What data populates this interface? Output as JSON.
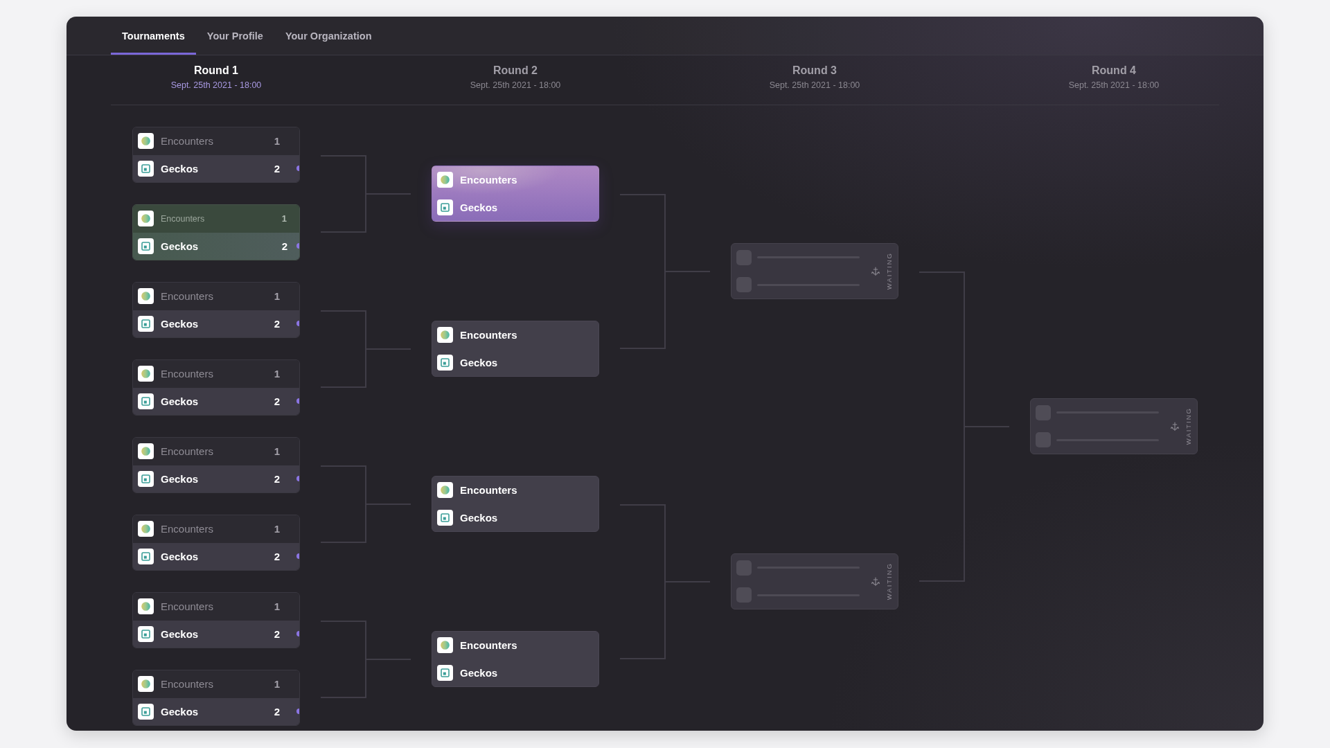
{
  "tabs": [
    {
      "label": "Tournaments",
      "selected": true
    },
    {
      "label": "Your Profile",
      "selected": false
    },
    {
      "label": "Your Organization",
      "selected": false
    }
  ],
  "rounds": [
    {
      "title": "Round 1",
      "date": "Sept. 25th 2021 - 18:00",
      "selected": true,
      "matches": [
        {
          "kind": "played",
          "hovered": false,
          "teams": [
            {
              "name": "Encounters",
              "score": "1",
              "winner": false
            },
            {
              "name": "Geckos",
              "score": "2",
              "winner": true
            }
          ]
        },
        {
          "kind": "played",
          "hovered": true,
          "teams": [
            {
              "name": "Encounters",
              "score": "1",
              "winner": false
            },
            {
              "name": "Geckos",
              "score": "2",
              "winner": true
            }
          ]
        },
        {
          "kind": "played",
          "hovered": false,
          "teams": [
            {
              "name": "Encounters",
              "score": "1",
              "winner": false
            },
            {
              "name": "Geckos",
              "score": "2",
              "winner": true
            }
          ]
        },
        {
          "kind": "played",
          "hovered": false,
          "teams": [
            {
              "name": "Encounters",
              "score": "1",
              "winner": false
            },
            {
              "name": "Geckos",
              "score": "2",
              "winner": true
            }
          ]
        },
        {
          "kind": "played",
          "hovered": false,
          "teams": [
            {
              "name": "Encounters",
              "score": "1",
              "winner": false
            },
            {
              "name": "Geckos",
              "score": "2",
              "winner": true
            }
          ]
        },
        {
          "kind": "played",
          "hovered": false,
          "teams": [
            {
              "name": "Encounters",
              "score": "1",
              "winner": false
            },
            {
              "name": "Geckos",
              "score": "2",
              "winner": true
            }
          ]
        },
        {
          "kind": "played",
          "hovered": false,
          "teams": [
            {
              "name": "Encounters",
              "score": "1",
              "winner": false
            },
            {
              "name": "Geckos",
              "score": "2",
              "winner": true
            }
          ]
        },
        {
          "kind": "played",
          "hovered": false,
          "teams": [
            {
              "name": "Encounters",
              "score": "1",
              "winner": false
            },
            {
              "name": "Geckos",
              "score": "2",
              "winner": true
            }
          ]
        }
      ]
    },
    {
      "title": "Round 2",
      "date": "Sept. 25th 2021 - 18:00",
      "selected": false,
      "matches": [
        {
          "kind": "upcoming",
          "selected": true,
          "teams": [
            {
              "name": "Encounters"
            },
            {
              "name": "Geckos"
            }
          ]
        },
        {
          "kind": "upcoming",
          "selected": false,
          "teams": [
            {
              "name": "Encounters"
            },
            {
              "name": "Geckos"
            }
          ]
        },
        {
          "kind": "upcoming",
          "selected": false,
          "teams": [
            {
              "name": "Encounters"
            },
            {
              "name": "Geckos"
            }
          ]
        },
        {
          "kind": "upcoming",
          "selected": false,
          "teams": [
            {
              "name": "Encounters"
            },
            {
              "name": "Geckos"
            }
          ]
        }
      ]
    },
    {
      "title": "Round 3",
      "date": "Sept. 25th 2021 - 18:00",
      "selected": false,
      "matches": [
        {
          "kind": "waiting",
          "status": "WAITING"
        },
        {
          "kind": "waiting",
          "status": "WAITING"
        }
      ]
    },
    {
      "title": "Round 4",
      "date": "Sept. 25th 2021 - 18:00",
      "selected": false,
      "matches": [
        {
          "kind": "waiting",
          "status": "WAITING"
        }
      ]
    }
  ]
}
